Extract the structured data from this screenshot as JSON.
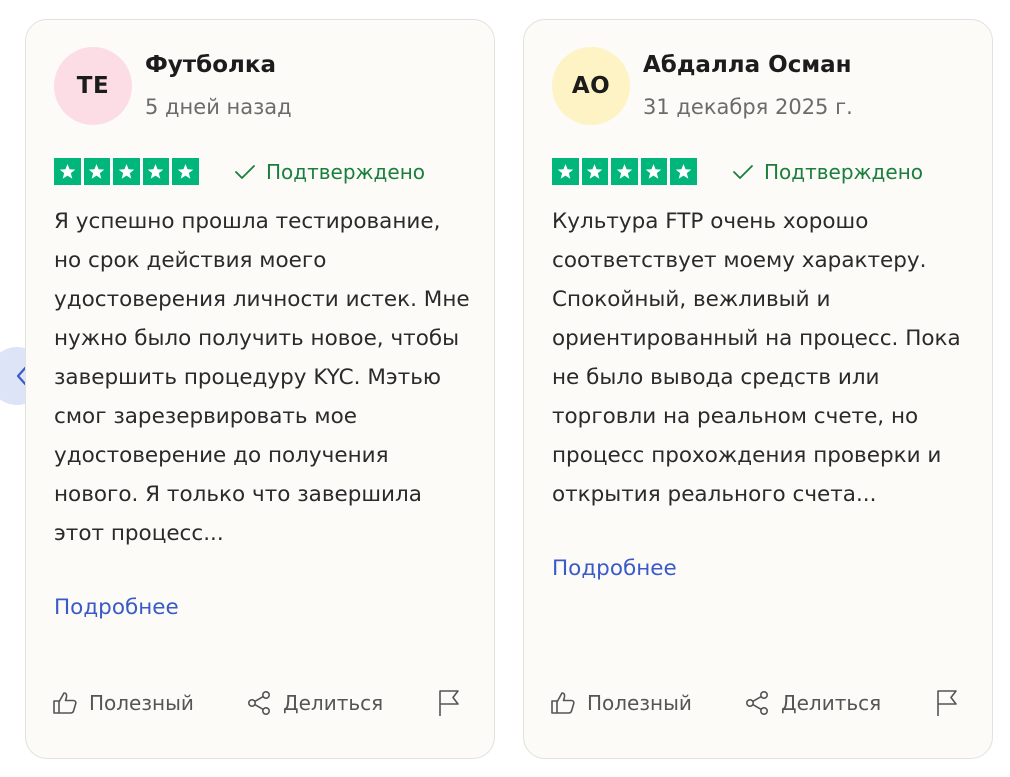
{
  "reviews": [
    {
      "initials": "TE",
      "avatar_color": "#fcdde6",
      "name": "Футболка",
      "date": "5 дней назад",
      "rating": 5,
      "verified_label": "Подтверждено",
      "text": "Я успешно прошла тестирование, но срок действия моего удостоверения личности истек. Мне нужно было получить новое, чтобы завершить процедуру KYC. Мэтью смог зарезервировать мое удостоверение до получения нового. Я только что завершила этот процесс...",
      "more_label": "Подробнее",
      "helpful_label": "Полезный",
      "share_label": "Делиться"
    },
    {
      "initials": "АО",
      "avatar_color": "#fdf3c4",
      "name": "Абдалла Осман",
      "date": "31 декабря 2025 г.",
      "rating": 5,
      "verified_label": "Подтверждено",
      "text": "Культура FTP очень хорошо соответствует моему характеру. Спокойный, вежливый и ориентированный на процесс. Пока не было вывода средств или торговли на реальном счете, но процесс прохождения проверки и открытия реального счета...",
      "more_label": "Подробнее",
      "helpful_label": "Полезный",
      "share_label": "Делиться"
    }
  ],
  "colors": {
    "star_green": "#00b67a",
    "verified_green": "#1a7f3c",
    "link_blue": "#3a5bc7",
    "nav_bg": "#dde4f7"
  },
  "icons": {
    "nav": "chevron-left-icon",
    "star": "star-icon",
    "verified": "checkmark-icon",
    "helpful": "thumbs-up-icon",
    "share": "share-icon",
    "flag": "flag-icon"
  }
}
